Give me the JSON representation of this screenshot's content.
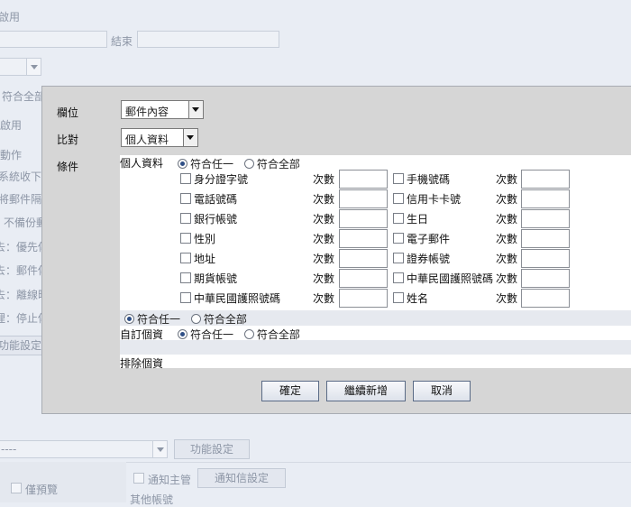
{
  "background": {
    "enable_label": "啟用",
    "end_label": "結束",
    "match_all_label": "符合全部",
    "enable2_label": "啟用",
    "action_label": "動作",
    "system_received_label": "系統收下",
    "isolate_label": "將郵件隔離",
    "no_backup_label": "不備份郵",
    "priority_label": "去：優先傳",
    "mail_label": "去：郵件傳",
    "offline_label": "去：離線時",
    "stop_label": "理：停止傳",
    "function_settings_label": "功能設定",
    "select_placeholder": "----",
    "function_settings_button": "功能設定",
    "preview_only_label": "僅預覽",
    "notify_manager_label": "通知主管",
    "notify_letter_button": "通知信設定",
    "other_account_label": "其他帳號"
  },
  "dialog": {
    "field_label": "欄位",
    "field_value": "郵件內容",
    "compare_label": "比對",
    "compare_value": "個人資料",
    "condition_label": "條件",
    "personal_data": {
      "title": "個人資料",
      "match_any": "符合任一",
      "match_all": "符合全部",
      "count_label": "次數",
      "left_items": [
        "身分證字號",
        "電話號碼",
        "銀行帳號",
        "性別",
        "地址",
        "期貨帳號",
        "中華民國護照號碼"
      ],
      "right_items": [
        "手機號碼",
        "信用卡卡號",
        "生日",
        "電子郵件",
        "證券帳號",
        "中華民國護照號碼",
        "姓名"
      ]
    },
    "group_match_any": "符合任一",
    "group_match_all": "符合全部",
    "custom_data": {
      "title": "自訂個資",
      "match_any": "符合任一",
      "match_all": "符合全部"
    },
    "exclude_label": "排除個資",
    "buttons": {
      "confirm": "確定",
      "continue_add": "繼續新增",
      "cancel": "取消"
    }
  }
}
